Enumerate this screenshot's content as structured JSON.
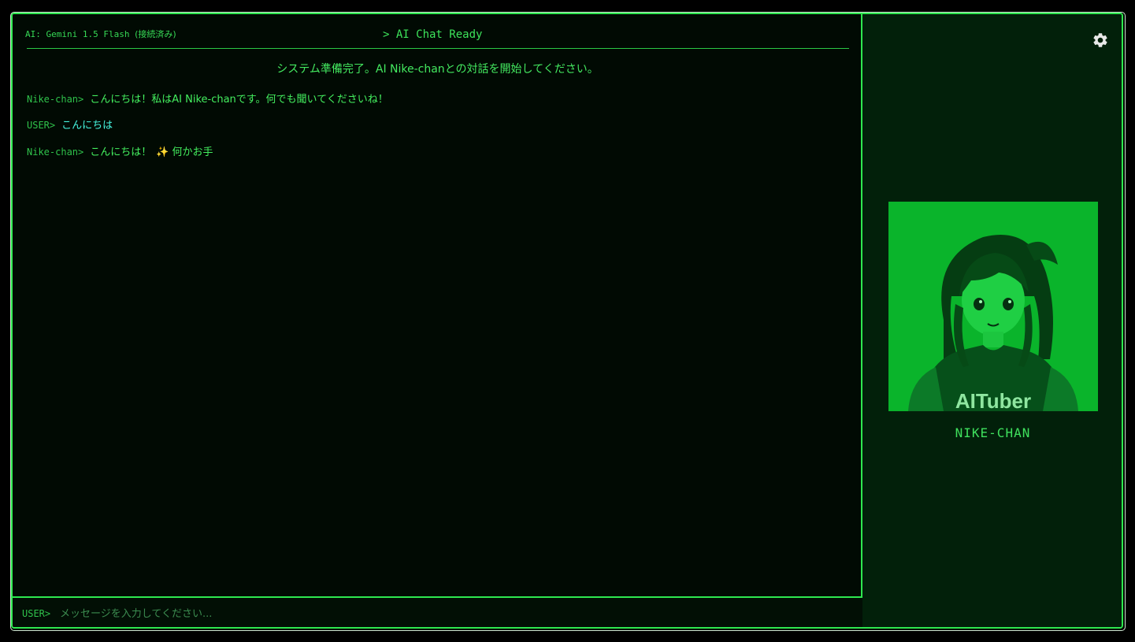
{
  "status": {
    "ai_label": "AI: Gemini 1.5 Flash",
    "connection": "(接続済み)"
  },
  "header": {
    "title": "> AI Chat Ready"
  },
  "system_message": "システム準備完了。AI Nike-chanとの対話を開始してください。",
  "messages": [
    {
      "speaker": "Nike-chan>",
      "text": "こんにちは！私はAI Nike-chanです。何でも聞いてくださいね！",
      "role": "ai"
    },
    {
      "speaker": "USER>",
      "text": "こんにちは",
      "role": "user"
    },
    {
      "speaker": "Nike-chan>",
      "text_before": "こんにちは！",
      "emoji": "✨",
      "text_after": "何かお手",
      "role": "ai"
    }
  ],
  "input": {
    "prefix": "USER>",
    "placeholder": "メッセージを入力してください..."
  },
  "side": {
    "settings_icon": "gear-icon",
    "avatar_caption": "AITuber",
    "avatar_name": "NIKE-CHAN"
  },
  "colors": {
    "accent": "#2ee84f",
    "background": "#010a03",
    "side_background": "#02200a",
    "user_text": "#46f5e0"
  }
}
